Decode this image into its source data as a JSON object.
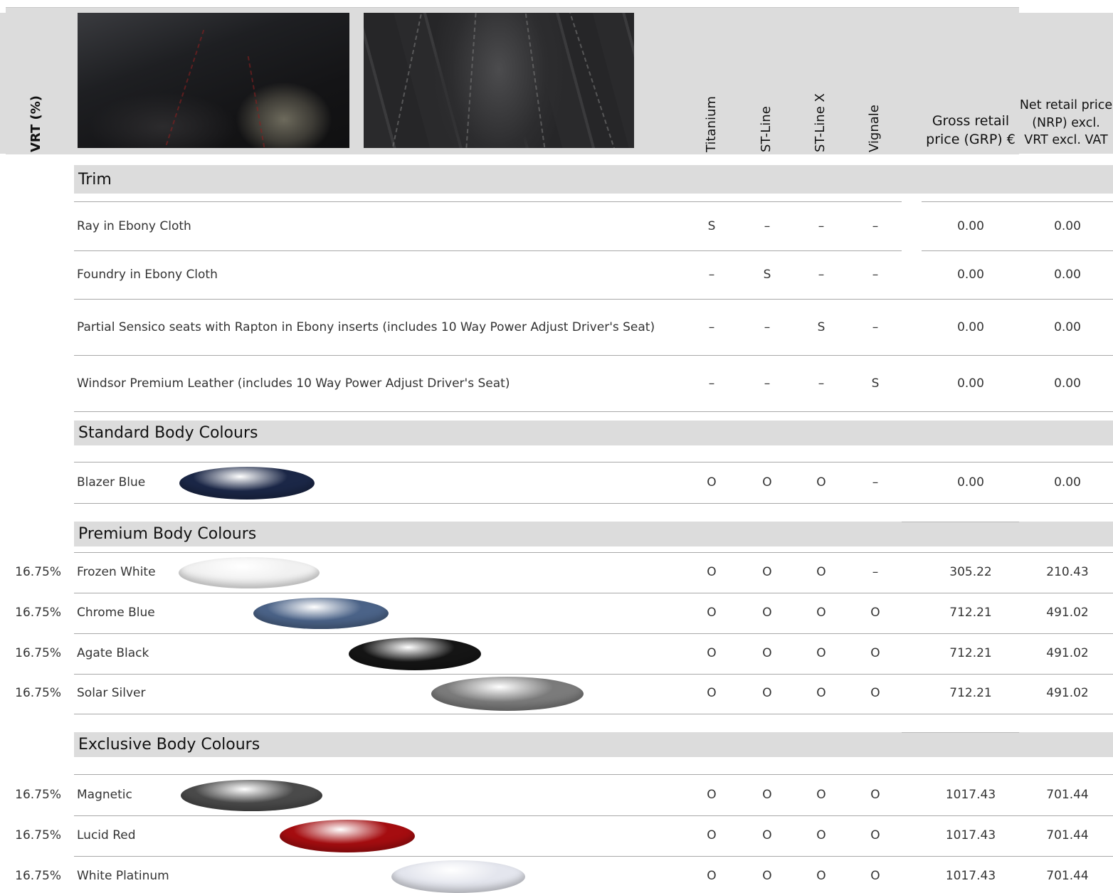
{
  "header": {
    "vrt_label": "VRT (%)",
    "columns": [
      "Titanium",
      "ST-Line",
      "ST-Line X",
      "Vignale"
    ],
    "grp_label_line1": "Gross retail",
    "grp_label_line2": "price (GRP) €",
    "nrp_label_line1": "Net retail price",
    "nrp_label_line2": "(NRP) excl.",
    "nrp_label_line3": "VRT excl. VAT"
  },
  "sections": {
    "trim": "Trim",
    "standard": "Standard Body Colours",
    "premium": "Premium Body Colours",
    "exclusive": "Exclusive Body Colours"
  },
  "trim_rows": [
    {
      "name": "Ray in Ebony Cloth",
      "titanium": "S",
      "stline": "–",
      "stlinex": "–",
      "vignale": "–",
      "grp": "0.00",
      "nrp": "0.00"
    },
    {
      "name": "Foundry in Ebony Cloth",
      "titanium": "–",
      "stline": "S",
      "stlinex": "–",
      "vignale": "–",
      "grp": "0.00",
      "nrp": "0.00"
    },
    {
      "name": "Partial Sensico seats with Rapton in Ebony inserts (includes 10 Way Power Adjust Driver's Seat)",
      "titanium": "–",
      "stline": "–",
      "stlinex": "S",
      "vignale": "–",
      "grp": "0.00",
      "nrp": "0.00"
    },
    {
      "name": "Windsor Premium Leather  (includes 10 Way Power Adjust Driver's Seat)",
      "titanium": "–",
      "stline": "–",
      "stlinex": "–",
      "vignale": "S",
      "grp": "0.00",
      "nrp": "0.00"
    }
  ],
  "standard_rows": [
    {
      "name": "Blazer Blue",
      "vrt": "",
      "titanium": "O",
      "stline": "O",
      "stlinex": "O",
      "vignale": "–",
      "grp": "0.00",
      "nrp": "0.00",
      "color": "#1b2747"
    }
  ],
  "premium_rows": [
    {
      "name": "Frozen White",
      "vrt": "16.75%",
      "titanium": "O",
      "stline": "O",
      "stlinex": "O",
      "vignale": "–",
      "grp": "305.22",
      "nrp": "210.43",
      "color": "#f1f1f1"
    },
    {
      "name": "Chrome Blue",
      "vrt": "16.75%",
      "titanium": "O",
      "stline": "O",
      "stlinex": "O",
      "vignale": "O",
      "grp": "712.21",
      "nrp": "491.02",
      "color": "#4b6388"
    },
    {
      "name": "Agate Black",
      "vrt": "16.75%",
      "titanium": "O",
      "stline": "O",
      "stlinex": "O",
      "vignale": "O",
      "grp": "712.21",
      "nrp": "491.02",
      "color": "#151515"
    },
    {
      "name": "Solar Silver",
      "vrt": "16.75%",
      "titanium": "O",
      "stline": "O",
      "stlinex": "O",
      "vignale": "O",
      "grp": "712.21",
      "nrp": "491.02",
      "color": "#7b7b7b"
    }
  ],
  "exclusive_rows": [
    {
      "name": "Magnetic",
      "vrt": "16.75%",
      "titanium": "O",
      "stline": "O",
      "stlinex": "O",
      "vignale": "O",
      "grp": "1017.43",
      "nrp": "701.44",
      "color": "#4a4a4a"
    },
    {
      "name": "Lucid Red",
      "vrt": "16.75%",
      "titanium": "O",
      "stline": "O",
      "stlinex": "O",
      "vignale": "O",
      "grp": "1017.43",
      "nrp": "701.44",
      "color": "#a50d10"
    },
    {
      "name": "White Platinum",
      "vrt": "16.75%",
      "titanium": "O",
      "stline": "O",
      "stlinex": "O",
      "vignale": "O",
      "grp": "1017.43",
      "nrp": "701.44",
      "color": "#e4e6ee"
    }
  ]
}
